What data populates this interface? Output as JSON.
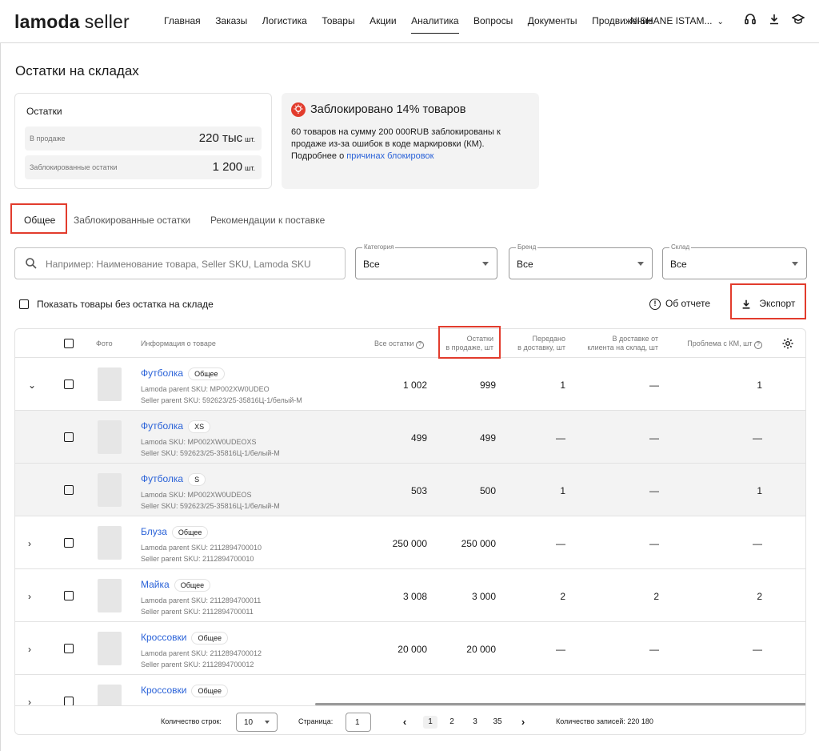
{
  "header": {
    "logo_bold": "lamoda",
    "logo_rest": "seller",
    "nav": [
      "Главная",
      "Заказы",
      "Логистика",
      "Товары",
      "Акции",
      "Аналитика",
      "Вопросы",
      "Документы",
      "Продвижение"
    ],
    "active_nav": "Аналитика",
    "account": "NISHANE ISTAM..."
  },
  "page": {
    "title": "Остатки на складах"
  },
  "stock_card": {
    "title": "Остатки",
    "on_sale_label": "В продаже",
    "on_sale_value": "220 тыс",
    "on_sale_unit": "шт.",
    "blocked_label": "Заблокированные остатки",
    "blocked_value": "1 200",
    "blocked_unit": "шт."
  },
  "blocked_card": {
    "heading": "Заблокировано 14% товаров",
    "body": "60 товаров на сумму 200 000RUB заблокированы к продаже из-за ошибок в коде маркировки (КМ). Подробнее о ",
    "link": "причинах блокировок"
  },
  "tabs": [
    "Общее",
    "Заблокированные остатки",
    "Рекомендации к поставке"
  ],
  "filters": {
    "search_placeholder": "Например: Наименование товара, Seller SKU, Lamoda SKU",
    "category_label": "Категория",
    "category_value": "Все",
    "brand_label": "Бренд",
    "brand_value": "Все",
    "warehouse_label": "Склад",
    "warehouse_value": "Все"
  },
  "toolbar": {
    "show_no_stock": "Показать товары без остатка на складе",
    "about": "Об отчете",
    "export": "Экспорт"
  },
  "table": {
    "headers": {
      "photo": "Фото",
      "info": "Информация о товаре",
      "all_stock": "Все остатки",
      "on_sale_1": "Остатки",
      "on_sale_2": "в продаже, шт",
      "to_delivery_1": "Передано",
      "to_delivery_2": "в доставку, шт",
      "in_delivery_1": "В доставке от",
      "in_delivery_2": "клиента на склад, шт",
      "km_problem": "Проблема с КМ, шт"
    },
    "rows": [
      {
        "expander": "⌄",
        "name": "Футболка",
        "tag": "Общее",
        "s1": "Lamoda parent SKU: MP002XW0UDEO",
        "s2": "Seller parent SKU: 592623/25-35816Ц-1/белый-M",
        "all": "1 002",
        "sale": "999",
        "tod": "1",
        "ind": "—",
        "km": "1",
        "child": false
      },
      {
        "expander": "",
        "name": "Футболка",
        "tag": "XS",
        "s1": "Lamoda SKU: MP002XW0UDEOXS",
        "s2": "Seller SKU: 592623/25-35816Ц-1/белый-M",
        "all": "499",
        "sale": "499",
        "tod": "—",
        "ind": "—",
        "km": "—",
        "child": true
      },
      {
        "expander": "",
        "name": "Футболка",
        "tag": "S",
        "s1": "Lamoda SKU: MP002XW0UDEOS",
        "s2": "Seller SKU: 592623/25-35816Ц-1/белый-M",
        "all": "503",
        "sale": "500",
        "tod": "1",
        "ind": "—",
        "km": "1",
        "child": true
      },
      {
        "expander": "›",
        "name": "Блуза",
        "tag": "Общее",
        "s1": "Lamoda parent SKU: 2112894700010",
        "s2": "Seller parent SKU: 2112894700010",
        "all": "250 000",
        "sale": "250 000",
        "tod": "—",
        "ind": "—",
        "km": "—",
        "child": false
      },
      {
        "expander": "›",
        "name": "Майка",
        "tag": "Общее",
        "s1": "Lamoda parent SKU: 2112894700011",
        "s2": "Seller parent SKU: 2112894700011",
        "all": "3 008",
        "sale": "3 000",
        "tod": "2",
        "ind": "2",
        "km": "2",
        "child": false
      },
      {
        "expander": "›",
        "name": "Кроссовки",
        "tag": "Общее",
        "s1": "Lamoda parent SKU: 2112894700012",
        "s2": "Seller parent SKU: 2112894700012",
        "all": "20 000",
        "sale": "20 000",
        "tod": "—",
        "ind": "—",
        "km": "—",
        "child": false
      },
      {
        "expander": "›",
        "name": "Кроссовки",
        "tag": "Общее",
        "s1": "",
        "s2": "",
        "all": "",
        "sale": "",
        "tod": "",
        "ind": "",
        "km": "",
        "child": false
      }
    ]
  },
  "footer": {
    "rows_label": "Количество строк:",
    "rows_value": "10",
    "page_label": "Страница:",
    "page_value": "1",
    "pages": [
      "1",
      "2",
      "3",
      "35"
    ],
    "total": "Количество записей: 220 180"
  },
  "colors": {
    "accent_red": "#e23c2d",
    "link_blue": "#2a62d8"
  }
}
